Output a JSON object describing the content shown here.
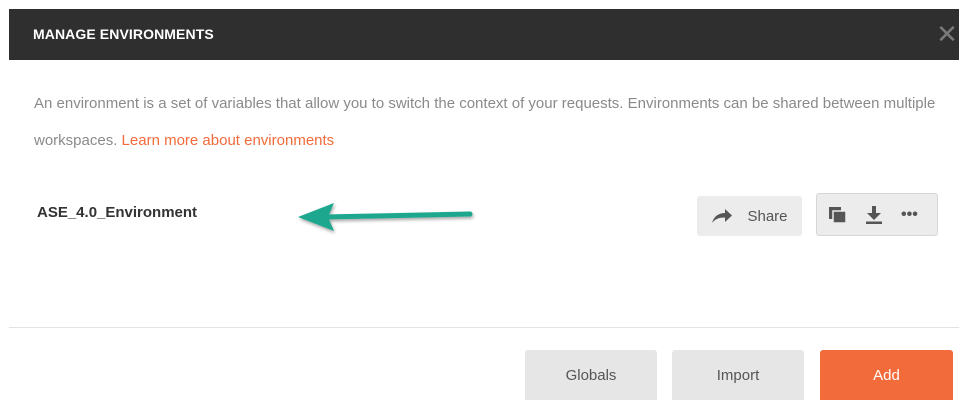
{
  "modal": {
    "title": "MANAGE ENVIRONMENTS",
    "description_part1": "An environment is a set of variables that allow you to switch the context of your requests. Environments can be shared between multiple workspaces.",
    "learn_more_link": "Learn more about environments"
  },
  "environment": {
    "name": "ASE_4.0_Environment",
    "share_label": "Share"
  },
  "icons": {
    "close": "close-icon",
    "share": "share-arrow-icon",
    "duplicate": "duplicate-icon",
    "download": "download-icon",
    "more": "more-icon",
    "annotation": "annotation-arrow"
  },
  "footer": {
    "globals_label": "Globals",
    "import_label": "Import",
    "add_label": "Add"
  },
  "colors": {
    "header_bg": "#2f2f2f",
    "accent": "#f26b3a",
    "annotation_arrow": "#1aa78e",
    "button_bg": "#e6e6e6"
  }
}
